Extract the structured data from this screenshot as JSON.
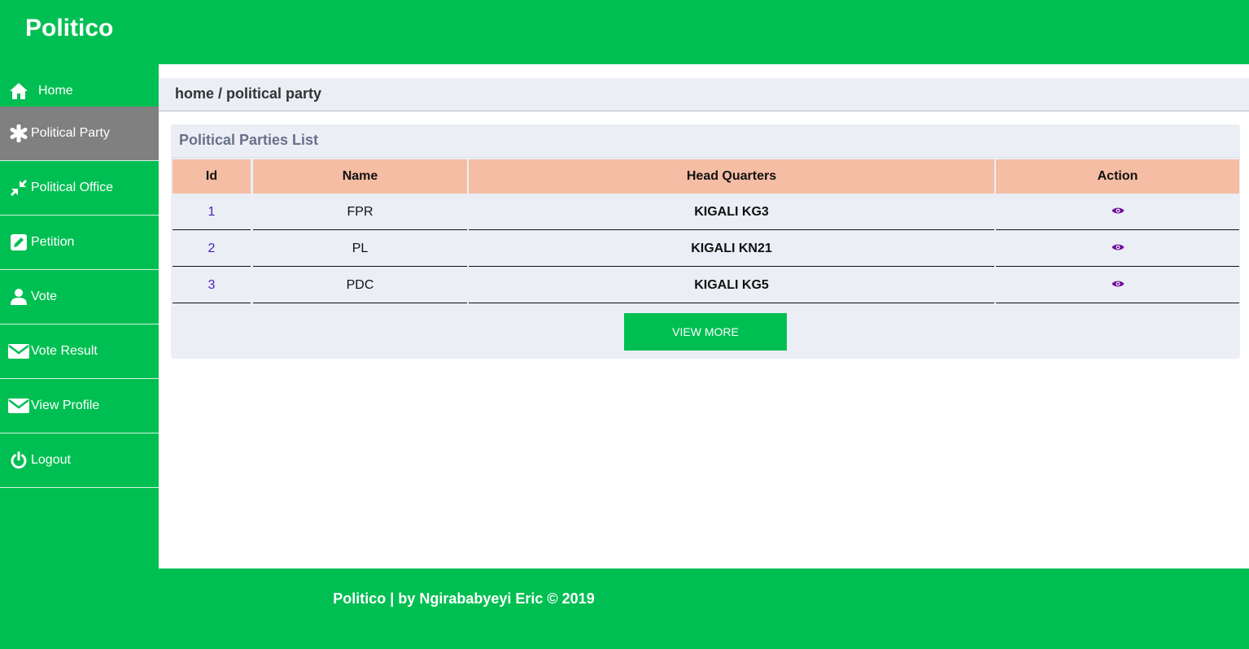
{
  "app": {
    "brand": "Politico"
  },
  "sidebar": {
    "items": [
      {
        "label": "Home",
        "icon": "home-icon",
        "active": false
      },
      {
        "label": "Political Party",
        "icon": "asterisk-icon",
        "active": true
      },
      {
        "label": "Political Office",
        "icon": "compress-icon",
        "active": false
      },
      {
        "label": "Petition",
        "icon": "edit-icon",
        "active": false
      },
      {
        "label": "Vote",
        "icon": "user-icon",
        "active": false
      },
      {
        "label": "Vote Result",
        "icon": "envelope-icon",
        "active": false
      },
      {
        "label": "View Profile",
        "icon": "envelope-icon",
        "active": false
      },
      {
        "label": "Logout",
        "icon": "power-icon",
        "active": false
      }
    ]
  },
  "breadcrumb": "home / political party",
  "card": {
    "title": "Political Parties List",
    "columns": [
      "Id",
      "Name",
      "Head Quarters",
      "Action"
    ],
    "rows": [
      {
        "id": "1",
        "name": "FPR",
        "hq": "KIGALI KG3"
      },
      {
        "id": "2",
        "name": "PL",
        "hq": "KIGALI KN21"
      },
      {
        "id": "3",
        "name": "PDC",
        "hq": "KIGALI KG5"
      }
    ],
    "view_more": "VIEW MORE"
  },
  "footer": {
    "text": "Politico | by Ngirababyeyi Eric © 2019"
  },
  "colors": {
    "brand": "#00bf52",
    "header_cell": "#f5bda4",
    "active_nav": "#808080",
    "panel": "#ebeef5"
  }
}
